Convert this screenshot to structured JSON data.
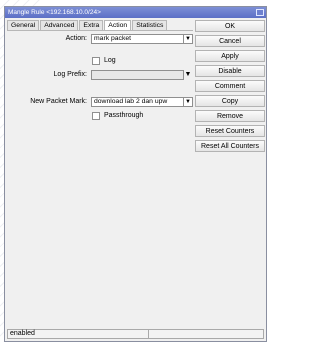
{
  "window": {
    "title": "Mangle Rule <192.168.10.0/24>"
  },
  "tabs": [
    {
      "label": "General"
    },
    {
      "label": "Advanced"
    },
    {
      "label": "Extra"
    },
    {
      "label": "Action"
    },
    {
      "label": "Statistics"
    }
  ],
  "form": {
    "action_label": "Action:",
    "action_value": "mark packet",
    "log_label": "Log",
    "log_prefix_label": "Log Prefix:",
    "log_prefix_value": "",
    "new_packet_mark_label": "New Packet Mark:",
    "new_packet_mark_value": "download lab 2 dan upw",
    "passthrough_label": "Passthrough"
  },
  "buttons": [
    {
      "label": "OK"
    },
    {
      "label": "Cancel"
    },
    {
      "label": "Apply"
    },
    {
      "label": "Disable"
    },
    {
      "label": "Comment"
    },
    {
      "label": "Copy"
    },
    {
      "label": "Remove"
    },
    {
      "label": "Reset Counters"
    },
    {
      "label": "Reset All Counters"
    }
  ],
  "status": {
    "text": "enabled"
  },
  "icons": {
    "dropdown": "dropdown-arrow-icon",
    "close": "window-close-icon"
  }
}
